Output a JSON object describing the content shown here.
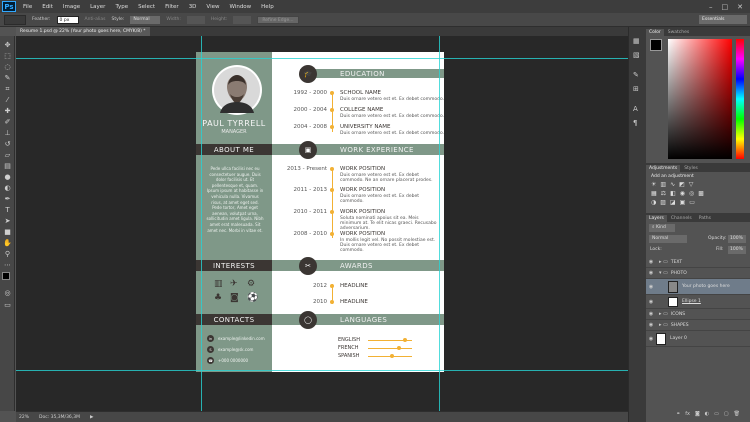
{
  "app": {
    "logo": "Ps"
  },
  "menu": [
    "File",
    "Edit",
    "Image",
    "Layer",
    "Type",
    "Select",
    "Filter",
    "3D",
    "View",
    "Window",
    "Help"
  ],
  "window_controls": {
    "minimize": "–",
    "maximize": "□",
    "close": "✕"
  },
  "options": {
    "feather_label": "Feather:",
    "feather_value": "0 px",
    "antialias_label": "Anti-alias",
    "style_label": "Style:",
    "style_value": "Normal",
    "width_label": "Width:",
    "height_label": "Height:",
    "refine_label": "Refine Edge...",
    "workspace": "Essentials"
  },
  "doc_tab": "Resume 1.psd @ 22% (Your photo goes here, CMYK/8) *",
  "status": {
    "zoom": "22%",
    "doc": "Doc: 35,3M/36,3M"
  },
  "tools": [
    "move-icon",
    "marquee-icon",
    "lasso-icon",
    "quick-select-icon",
    "crop-icon",
    "eyedropper-icon",
    "healing-icon",
    "brush-icon",
    "stamp-icon",
    "history-brush-icon",
    "eraser-icon",
    "gradient-icon",
    "blur-icon",
    "dodge-icon",
    "pen-icon",
    "type-icon",
    "path-select-icon",
    "shape-icon",
    "hand-icon",
    "zoom-icon"
  ],
  "resume": {
    "name": "PAUL TYRRELL",
    "title": "MANAGER",
    "about_title": "ABOUT ME",
    "about_text": "Pede ullca facilisi nec eu consectetuer augue. Duis dolor facilisis ut. Et pellentesque et, quam. Ipsum ipsum at habitasse in vehicula nulla. Vivamus risus, at amet eget sed. Pede tortor, Amet eget aenean, volutpat urna, sollicitudin amet ligula. Nibh amet erat malesuada. Sit amet nec. Morbi in vitae et.",
    "interests_title": "INTERESTS",
    "contacts_title": "CONTACTS",
    "contacts": [
      {
        "icon": "linkedin-icon",
        "glyph": "in",
        "text": "example@linkedin.com"
      },
      {
        "icon": "skype-icon",
        "glyph": "S",
        "text": "example@sk.com"
      },
      {
        "icon": "phone-icon",
        "glyph": "☎",
        "text": "+000 0000000"
      }
    ],
    "education_title": "EDUCATION",
    "education": [
      {
        "years": "1992 - 2000",
        "school": "SCHOOL NAME",
        "desc": "Duis ornare vetero est et. Ex debet commodo."
      },
      {
        "years": "2000 - 2004",
        "school": "COLLEGE NAME",
        "desc": "Duis ornare vetero est et. Ex debet commodo."
      },
      {
        "years": "2004 - 2008",
        "school": "UNIVERSITY NAME",
        "desc": "Duis ornare vetero est et. Ex debet commodo."
      }
    ],
    "work_title": "WORK EXPERIENCE",
    "work": [
      {
        "years": "2013 - Present",
        "pos": "WORK POSITION",
        "desc": "Duis ornare vetero est et. Ex debet commodo. Ne an ornare placerat prodes."
      },
      {
        "years": "2011 - 2013",
        "pos": "WORK POSITION",
        "desc": "Duis ornare vetero est et. Ex debet commodo."
      },
      {
        "years": "2010 - 2011",
        "pos": "WORK POSITION",
        "desc": "Soluta nominati apoius sit ea. Meis minimum at. Te elit nicas graeci. Recusabo adversarium."
      },
      {
        "years": "2008 - 2010",
        "pos": "WORK POSITION",
        "desc": "In mollis legit vel. No possit molestiae est. Duis ornare vetero est et. Ex debet commodo."
      }
    ],
    "awards_title": "AWARDS",
    "awards": [
      {
        "year": "2012",
        "label": "HEADLINE"
      },
      {
        "year": "2010",
        "label": "HEADLINE"
      }
    ],
    "languages_title": "LANGUAGES",
    "languages": [
      {
        "name": "ENGLISH",
        "level": 0.88
      },
      {
        "name": "FRENCH",
        "level": 0.72
      },
      {
        "name": "SPANISH",
        "level": 0.55
      }
    ]
  },
  "color_panel": {
    "tabs": [
      "Color",
      "Swatches"
    ]
  },
  "adjust_panel": {
    "tabs": [
      "Adjustments",
      "Styles"
    ],
    "heading": "Add an adjustment"
  },
  "layers_panel": {
    "tabs": [
      "Layers",
      "Channels",
      "Paths"
    ],
    "kind": "Kind",
    "blend": "Normal",
    "opacity_label": "Opacity:",
    "opacity": "100%",
    "lock_label": "Lock:",
    "fill_label": "Fill:",
    "fill": "100%",
    "layers": [
      {
        "name": "TEXT",
        "type": "folder"
      },
      {
        "name": "PHOTO",
        "type": "folder-open"
      },
      {
        "name": "Your photo goes here",
        "type": "image"
      },
      {
        "name": "Ellipse 1",
        "type": "shape"
      },
      {
        "name": "ICONS",
        "type": "folder"
      },
      {
        "name": "SHAPES",
        "type": "folder"
      },
      {
        "name": "Layer 0",
        "type": "layer"
      }
    ]
  },
  "colors": {
    "sidebar": "#7f9888",
    "dark": "#3b3633",
    "accent": "#f2b134",
    "guide": "#27d3d3"
  }
}
